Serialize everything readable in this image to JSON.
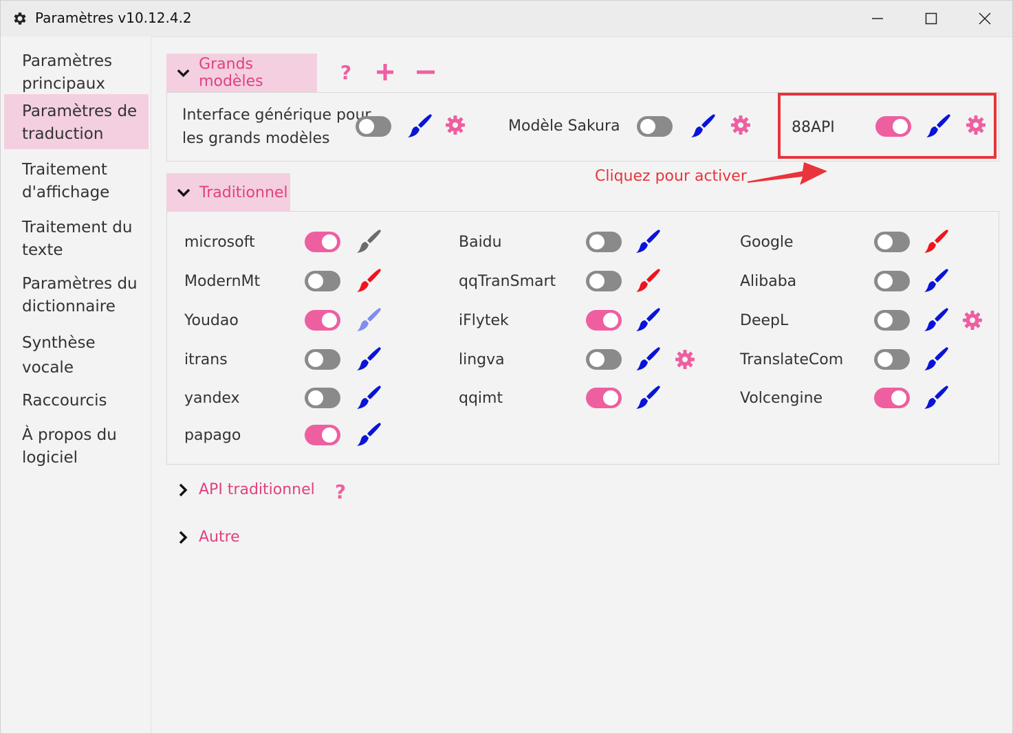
{
  "window": {
    "title": "Paramètres v10.12.4.2",
    "controls": {
      "minimize": "minimize-icon",
      "maximize": "maximize-icon",
      "close": "close-icon"
    }
  },
  "sidebar": {
    "items": [
      {
        "label_line1": "Paramètres",
        "label_line2": "principaux",
        "active": false
      },
      {
        "label_line1": "Paramètres de",
        "label_line2": "traduction",
        "active": true
      },
      {
        "label_line1": "Traitement",
        "label_line2": "d'affichage",
        "active": false
      },
      {
        "label_line1": "Traitement du",
        "label_line2": "texte",
        "active": false
      },
      {
        "label_line1": "Paramètres du",
        "label_line2": "dictionnaire",
        "active": false
      },
      {
        "label_line1": "Synthèse",
        "label_line2": "vocale",
        "active": false
      },
      {
        "label_line1": "Raccourcis",
        "label_line2": "",
        "active": false
      },
      {
        "label_line1": "À propos du",
        "label_line2": "logiciel",
        "active": false
      }
    ]
  },
  "large_models": {
    "header": "Grands modèles",
    "help": "?",
    "entries": [
      {
        "label_line1": "Interface générique pour",
        "label_line2": "les grands modèles",
        "enabled": false,
        "brush_color": "#0a14d8",
        "has_settings": true
      },
      {
        "label": "Modèle Sakura",
        "enabled": false,
        "brush_color": "#0a14d8",
        "has_settings": true
      },
      {
        "label": "88API",
        "enabled": true,
        "brush_color": "#0a14d8",
        "has_settings": true
      }
    ],
    "annotation": "Cliquez pour activer"
  },
  "traditional": {
    "header": "Traditionnel",
    "entries": [
      {
        "label": "microsoft",
        "enabled": true,
        "brush_color": "#6b6b6b",
        "has_settings": false
      },
      {
        "label": "Baidu",
        "enabled": false,
        "brush_color": "#0a14d8",
        "has_settings": false
      },
      {
        "label": "Google",
        "enabled": false,
        "brush_color": "#f0141e",
        "has_settings": false
      },
      {
        "label": "ModernMt",
        "enabled": false,
        "brush_color": "#f0141e",
        "has_settings": false
      },
      {
        "label": "qqTranSmart",
        "enabled": false,
        "brush_color": "#f0141e",
        "has_settings": false
      },
      {
        "label": "Alibaba",
        "enabled": false,
        "brush_color": "#0a14d8",
        "has_settings": false
      },
      {
        "label": "Youdao",
        "enabled": true,
        "brush_color": "#7e8ef0",
        "has_settings": false
      },
      {
        "label": "iFlytek",
        "enabled": true,
        "brush_color": "#0a14d8",
        "has_settings": false
      },
      {
        "label": "DeepL",
        "enabled": false,
        "brush_color": "#0a14d8",
        "has_settings": true
      },
      {
        "label": "itrans",
        "enabled": false,
        "brush_color": "#0a14d8",
        "has_settings": false
      },
      {
        "label": "lingva",
        "enabled": false,
        "brush_color": "#0a14d8",
        "has_settings": true
      },
      {
        "label": "TranslateCom",
        "enabled": false,
        "brush_color": "#0a14d8",
        "has_settings": false
      },
      {
        "label": "yandex",
        "enabled": false,
        "brush_color": "#0a14d8",
        "has_settings": false
      },
      {
        "label": "qqimt",
        "enabled": true,
        "brush_color": "#0a14d8",
        "has_settings": false
      },
      {
        "label": "Volcengine",
        "enabled": true,
        "brush_color": "#0a14d8",
        "has_settings": false
      },
      {
        "label": "papago",
        "enabled": true,
        "brush_color": "#0a14d8",
        "has_settings": false
      }
    ]
  },
  "collapsed_sections": {
    "api_traditional": {
      "label": "API traditionnel",
      "help": "?"
    },
    "other": {
      "label": "Autre"
    }
  },
  "colors": {
    "accent": "#ee5fa0",
    "header_bg": "#f3cfe0",
    "header_text": "#e2407f",
    "annotation": "#e8343a"
  }
}
